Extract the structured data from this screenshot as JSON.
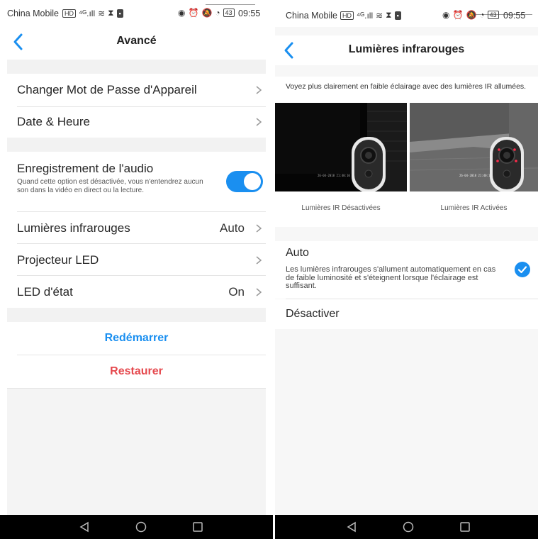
{
  "left": {
    "status": {
      "carrier": "China Mobile",
      "time": "09:55",
      "battery": "43"
    },
    "nav": {
      "title": "Avancé"
    },
    "rows": {
      "change_password": "Changer Mot de Passe d'Appareil",
      "date_time": "Date & Heure",
      "audio_title": "Enregistrement de l'audio",
      "audio_desc": "Quand cette option est désactivée, vous n'entendrez aucun son dans la vidéo en direct ou la lecture.",
      "ir_lights": "Lumières infrarouges",
      "ir_value": "Auto",
      "led_projector": "Projecteur LED",
      "status_led": "LED d'état",
      "status_led_value": "On"
    },
    "audio_toggle_on": true,
    "actions": {
      "reboot": "Redémarrer",
      "restore": "Restaurer"
    },
    "colors": {
      "accent": "#1a8ff0",
      "danger": "#e5484d",
      "reboot": "#1a8ff0"
    }
  },
  "right": {
    "status": {
      "carrier": "China Mobile",
      "time": "09:55",
      "battery": "43"
    },
    "nav": {
      "title": "Lumières infrarouges"
    },
    "description": "Voyez plus clairement en faible éclairage avec des lumières IR allumées.",
    "captions": {
      "off": "Lumières IR Désactivées",
      "on": "Lumières IR Activées"
    },
    "options": {
      "auto_label": "Auto",
      "auto_desc": "Les lumières infrarouges s'allument automatiquement en cas de faible luminosité et s'éteignent lorsque l'éclairage est suffisant.",
      "auto_selected": true,
      "off_label": "Désactiver"
    }
  }
}
